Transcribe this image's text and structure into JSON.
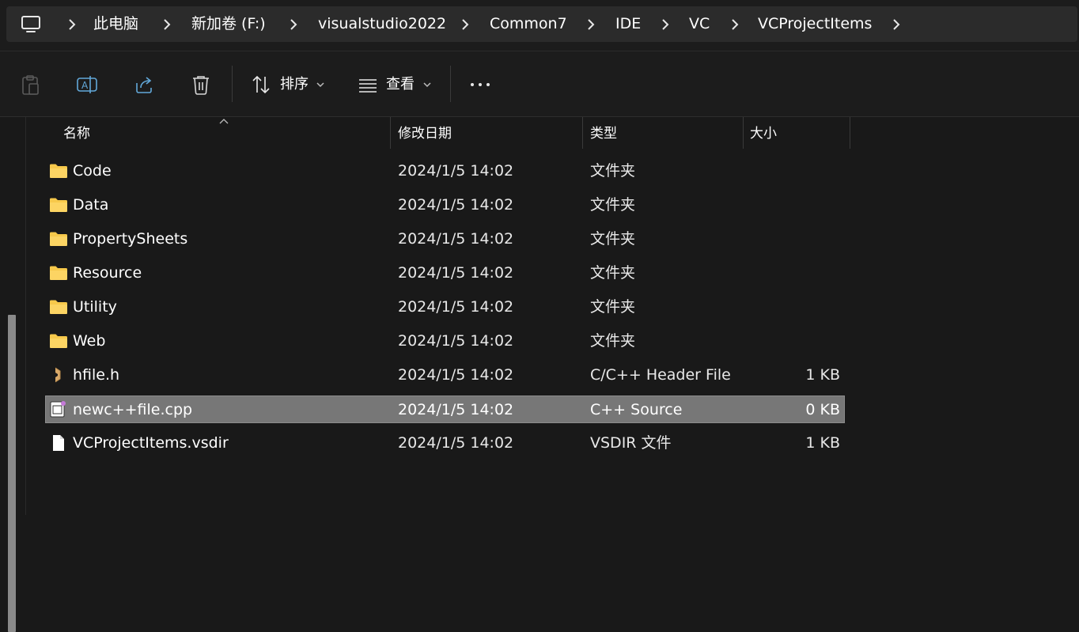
{
  "breadcrumb": [
    "此电脑",
    "新加卷 (F:)",
    "visualstudio2022",
    "Common7",
    "IDE",
    "VC",
    "VCProjectItems"
  ],
  "toolbar": {
    "icons": [
      "paste-icon",
      "rename-icon",
      "share-icon",
      "delete-icon",
      "more-icon"
    ],
    "sort_label": "排序",
    "view_label": "查看"
  },
  "columns": {
    "name": "名称",
    "date": "修改日期",
    "type": "类型",
    "size": "大小"
  },
  "files": [
    {
      "name": "Code",
      "date": "2024/1/5 14:02",
      "type": "文件夹",
      "size": "",
      "icon": "folder-icon",
      "selected": false
    },
    {
      "name": "Data",
      "date": "2024/1/5 14:02",
      "type": "文件夹",
      "size": "",
      "icon": "folder-icon",
      "selected": false
    },
    {
      "name": "PropertySheets",
      "date": "2024/1/5 14:02",
      "type": "文件夹",
      "size": "",
      "icon": "folder-icon",
      "selected": false
    },
    {
      "name": "Resource",
      "date": "2024/1/5 14:02",
      "type": "文件夹",
      "size": "",
      "icon": "folder-icon",
      "selected": false
    },
    {
      "name": "Utility",
      "date": "2024/1/5 14:02",
      "type": "文件夹",
      "size": "",
      "icon": "folder-icon",
      "selected": false
    },
    {
      "name": "Web",
      "date": "2024/1/5 14:02",
      "type": "文件夹",
      "size": "",
      "icon": "folder-icon",
      "selected": false
    },
    {
      "name": "hfile.h",
      "date": "2024/1/5 14:02",
      "type": "C/C++ Header File",
      "size": "1 KB",
      "icon": "header-file-icon",
      "selected": false
    },
    {
      "name": "newc++file.cpp",
      "date": "2024/1/5 14:02",
      "type": "C++ Source",
      "size": "0 KB",
      "icon": "cpp-file-icon",
      "selected": true
    },
    {
      "name": "VCProjectItems.vsdir",
      "date": "2024/1/5 14:02",
      "type": "VSDIR 文件",
      "size": "1 KB",
      "icon": "file-icon",
      "selected": false
    }
  ],
  "colors": {
    "background": "#191919",
    "selected_row": "#777777",
    "folder": "#f7c94b",
    "toolbar_icon": "#62a8d9"
  }
}
